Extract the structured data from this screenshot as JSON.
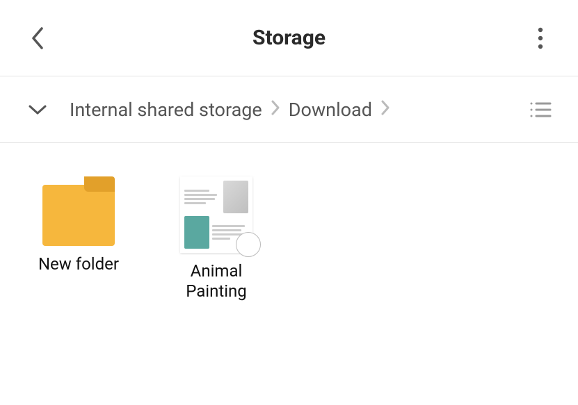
{
  "header": {
    "title": "Storage"
  },
  "breadcrumb": {
    "items": [
      "Internal shared storage",
      "Download"
    ]
  },
  "grid": {
    "items": [
      {
        "label": "New folder",
        "kind": "folder"
      },
      {
        "label": "Animal Painting",
        "kind": "document"
      }
    ]
  }
}
